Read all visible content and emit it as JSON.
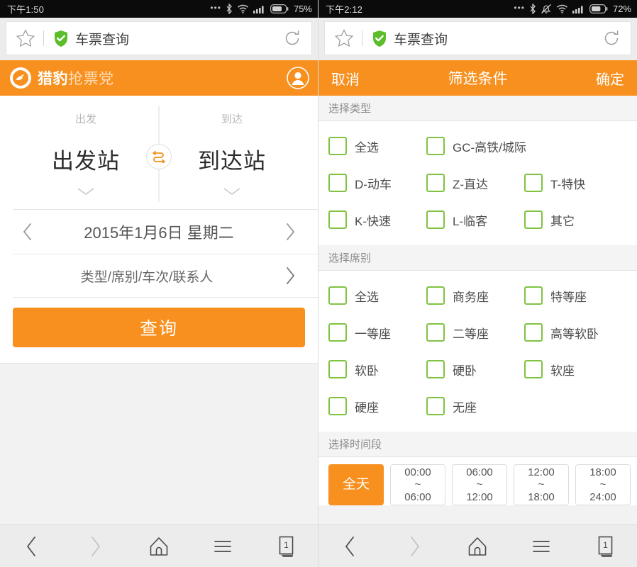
{
  "left": {
    "status": {
      "clock": "下午1:50",
      "battery_pct": "75%",
      "icons": [
        "dots-icon",
        "bluetooth-icon",
        "wifi-icon",
        "signal-icon",
        "battery-icon"
      ]
    },
    "chrome": {
      "star_icon": "star-icon",
      "shield_icon": "shield-check-icon",
      "title": "车票查询",
      "reload_icon": "reload-icon"
    },
    "appbar": {
      "logo_icon": "leopard-logo-icon",
      "brand_main": "猎豹",
      "brand_sub": "抢票党",
      "avatar_icon": "account-avatar-icon"
    },
    "form": {
      "depart_label": "出发",
      "depart_station": "出发站",
      "arrive_label": "到达",
      "arrive_station": "到达站",
      "swap_icon": "swap-stations-icon",
      "prev_icon": "chevron-left-icon",
      "next_icon": "chevron-right-icon",
      "date": "2015年1月6日 星期二",
      "options_label": "类型/席别/车次/联系人",
      "options_chevron": "chevron-right-icon",
      "search_button": "查询"
    }
  },
  "right": {
    "status": {
      "clock": "下午2:12",
      "battery_pct": "72%",
      "icons": [
        "dots-icon",
        "bluetooth-icon",
        "bell-muted-icon",
        "wifi-icon",
        "signal-icon",
        "battery-icon"
      ]
    },
    "chrome": {
      "star_icon": "star-icon",
      "shield_icon": "shield-check-icon",
      "title": "车票查询",
      "reload_icon": "reload-icon"
    },
    "filterbar": {
      "cancel": "取消",
      "title": "筛选条件",
      "confirm": "确定"
    },
    "sections": [
      {
        "heading": "选择类型",
        "rows": [
          [
            {
              "label": "全选",
              "checked": false
            },
            {
              "label": "GC-高铁/城际",
              "checked": false
            }
          ],
          [
            {
              "label": "D-动车",
              "checked": false
            },
            {
              "label": "Z-直达",
              "checked": false
            },
            {
              "label": "T-特快",
              "checked": false
            }
          ],
          [
            {
              "label": "K-快速",
              "checked": false
            },
            {
              "label": "L-临客",
              "checked": false
            },
            {
              "label": "其它",
              "checked": false
            }
          ]
        ]
      },
      {
        "heading": "选择席别",
        "rows": [
          [
            {
              "label": "全选",
              "checked": false
            },
            {
              "label": "商务座",
              "checked": false
            },
            {
              "label": "特等座",
              "checked": false
            }
          ],
          [
            {
              "label": "一等座",
              "checked": false
            },
            {
              "label": "二等座",
              "checked": false
            },
            {
              "label": "高等软卧",
              "checked": false
            }
          ],
          [
            {
              "label": "软卧",
              "checked": false
            },
            {
              "label": "硬卧",
              "checked": false
            },
            {
              "label": "软座",
              "checked": false
            }
          ],
          [
            {
              "label": "硬座",
              "checked": false
            },
            {
              "label": "无座",
              "checked": false
            }
          ]
        ]
      }
    ],
    "time_section": {
      "heading": "选择时间段",
      "buttons": [
        {
          "line1": "全天",
          "line2": "",
          "line3": "",
          "active": true
        },
        {
          "line1": "00:00",
          "line2": "~",
          "line3": "06:00",
          "active": false
        },
        {
          "line1": "06:00",
          "line2": "~",
          "line3": "12:00",
          "active": false
        },
        {
          "line1": "12:00",
          "line2": "~",
          "line3": "18:00",
          "active": false
        },
        {
          "line1": "18:00",
          "line2": "~",
          "line3": "24:00",
          "active": false
        }
      ]
    }
  },
  "navbar": {
    "buttons": [
      "back-icon",
      "forward-icon",
      "home-icon",
      "menu-icon",
      "tabs-icon"
    ],
    "tab_count": "1"
  },
  "colors": {
    "orange": "#F7901E",
    "green": "#80C342",
    "status_bar": "#0B0B0B",
    "chrome_grey": "#ECECEC",
    "page_grey": "#F2F2F2"
  }
}
